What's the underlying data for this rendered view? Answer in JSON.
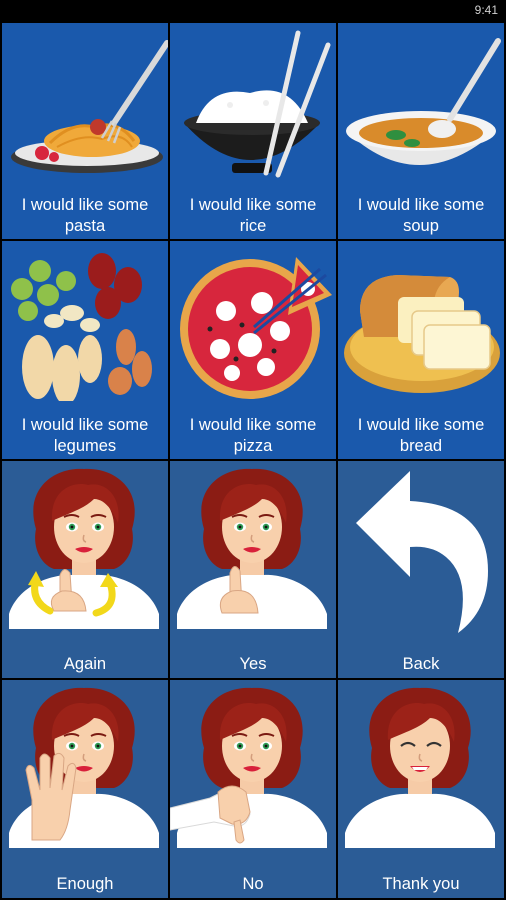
{
  "status": {
    "time": "9:41"
  },
  "tiles": [
    {
      "line1": "I would like some",
      "line2": "pasta",
      "icon": "pasta-icon"
    },
    {
      "line1": "I would like some",
      "line2": "rice",
      "icon": "rice-icon"
    },
    {
      "line1": "I would like some",
      "line2": "soup",
      "icon": "soup-icon"
    },
    {
      "line1": "I would like some",
      "line2": "legumes",
      "icon": "legumes-icon"
    },
    {
      "line1": "I would like some",
      "line2": "pizza",
      "icon": "pizza-icon"
    },
    {
      "line1": "I would like some",
      "line2": "bread",
      "icon": "bread-icon"
    },
    {
      "label": "Again",
      "icon": "again-gesture-icon"
    },
    {
      "label": "Yes",
      "icon": "yes-gesture-icon"
    },
    {
      "label": "Back",
      "icon": "back-arrow-icon"
    },
    {
      "label": "Enough",
      "icon": "enough-gesture-icon"
    },
    {
      "label": "No",
      "icon": "no-gesture-icon"
    },
    {
      "label": "Thank you",
      "icon": "thank-you-gesture-icon"
    }
  ],
  "colors": {
    "food_tile": "#1a59ac",
    "gesture_tile": "#2b5c96"
  }
}
